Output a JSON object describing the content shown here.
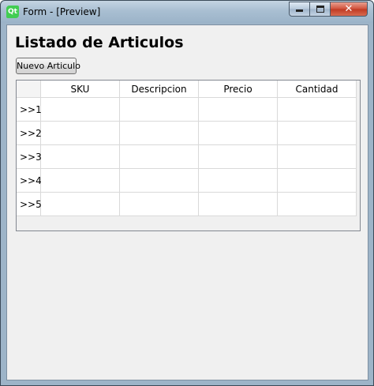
{
  "window": {
    "title": "Form - [Preview]",
    "app_icon": "qt-logo-icon",
    "app_icon_text": "Qt",
    "controls": {
      "minimize": "minimize-icon",
      "maximize": "maximize-icon",
      "close_glyph": "✕"
    }
  },
  "form": {
    "heading": "Listado de Articulos",
    "new_button_label": "Nuevo Articulo"
  },
  "table": {
    "columns": [
      "SKU",
      "Descripcion",
      "Precio",
      "Cantidad"
    ],
    "row_headers": [
      ">>1",
      ">>2",
      ">>3",
      ">>4",
      ">>5"
    ],
    "rows": [
      [
        "",
        "",
        "",
        ""
      ],
      [
        "",
        "",
        "",
        ""
      ],
      [
        "",
        "",
        "",
        ""
      ],
      [
        "",
        "",
        "",
        ""
      ],
      [
        "",
        "",
        "",
        ""
      ]
    ]
  }
}
